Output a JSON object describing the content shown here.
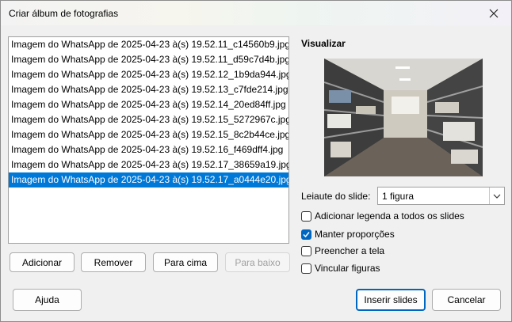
{
  "dialog": {
    "title": "Criar álbum de fotografias",
    "close_icon": "close-icon"
  },
  "files": [
    "Imagem do WhatsApp de 2025-04-23 à(s) 19.52.11_c14560b9.jpg",
    "Imagem do WhatsApp de 2025-04-23 à(s) 19.52.11_d59c7d4b.jpg",
    "Imagem do WhatsApp de 2025-04-23 à(s) 19.52.12_1b9da944.jpg",
    "Imagem do WhatsApp de 2025-04-23 à(s) 19.52.13_c7fde214.jpg",
    "Imagem do WhatsApp de 2025-04-23 à(s) 19.52.14_20ed84ff.jpg",
    "Imagem do WhatsApp de 2025-04-23 à(s) 19.52.15_5272967c.jpg",
    "Imagem do WhatsApp de 2025-04-23 à(s) 19.52.15_8c2b44ce.jpg",
    "Imagem do WhatsApp de 2025-04-23 à(s) 19.52.16_f469dff4.jpg",
    "Imagem do WhatsApp de 2025-04-23 à(s) 19.52.17_38659a19.jpg",
    "Imagem do WhatsApp de 2025-04-23 à(s) 19.52.17_a0444e20.jpg"
  ],
  "selected_index": 9,
  "list_buttons": {
    "add": "Adicionar",
    "remove": "Remover",
    "move_up": "Para cima",
    "move_down": "Para baixo"
  },
  "preview": {
    "heading": "Visualizar"
  },
  "layout": {
    "label": "Leiaute do slide:",
    "value": "1 figura"
  },
  "options": {
    "caption": {
      "label": "Adicionar legenda a todos os slides",
      "checked": false
    },
    "keep_ratio": {
      "label": "Manter proporções",
      "checked": true
    },
    "fill_screen": {
      "label": "Preencher a tela",
      "checked": false
    },
    "link_pictures": {
      "label": "Vincular figuras",
      "checked": false
    }
  },
  "footer": {
    "help": "Ajuda",
    "insert": "Inserir slides",
    "cancel": "Cancelar"
  },
  "colors": {
    "selection": "#0078d7",
    "accent": "#0067c0"
  }
}
